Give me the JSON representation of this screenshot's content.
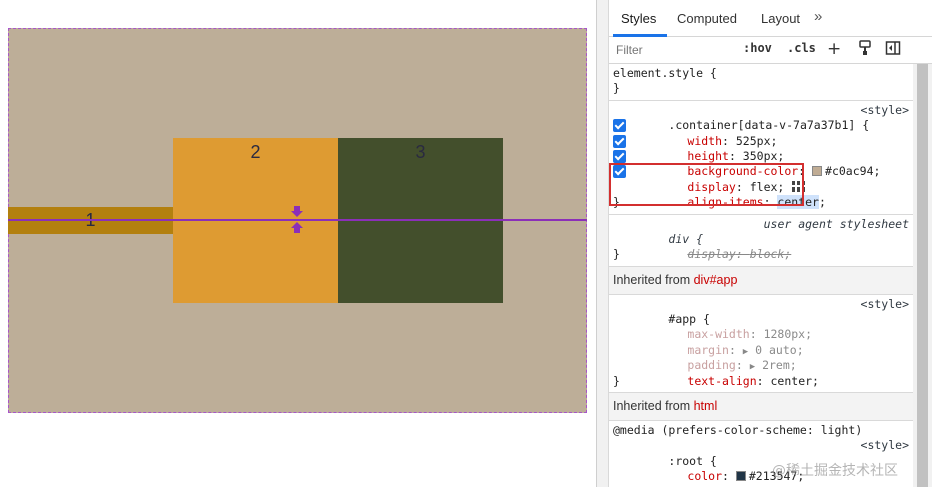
{
  "preview": {
    "box1_label": "1",
    "box2_label": "2",
    "box3_label": "3",
    "colors": {
      "container": "#bdae98",
      "box1": "#b3800f",
      "box2": "#de9b32",
      "box3": "#434f2c",
      "center_line": "#8b2fb8"
    }
  },
  "devtools": {
    "tabs": [
      "Styles",
      "Computed",
      "Layout"
    ],
    "more_tabs_icon": "»",
    "filter_placeholder": "Filter",
    "toolbar": {
      "hov": ":hov",
      "cls": ".cls",
      "plus": "+"
    },
    "rules": {
      "element_style": {
        "selector": "element.style {",
        "close": "}"
      },
      "container": {
        "selector": ".container[data-v-7a7a37b1] {",
        "source": "<style>",
        "decls": [
          {
            "prop": "width",
            "value": "525px;"
          },
          {
            "prop": "height",
            "value": "350px;"
          },
          {
            "prop": "background-color",
            "value": "#c0ac94;"
          },
          {
            "prop": "display",
            "value": "flex;"
          },
          {
            "prop": "align-items",
            "value": "center"
          }
        ],
        "close": "}"
      },
      "div_ua": {
        "selector": "div {",
        "source": "user agent stylesheet",
        "decl_prop": "display",
        "decl_value": "block;",
        "close": "}"
      },
      "inherited_app": {
        "header_prefix": "Inherited from",
        "header_tag": "div#app",
        "selector": "#app {",
        "source": "<style>",
        "decls": [
          {
            "prop": "max-width",
            "value": "1280px;"
          },
          {
            "prop": "margin",
            "value": "0 auto;"
          },
          {
            "prop": "padding",
            "value": "2rem;"
          },
          {
            "prop": "text-align",
            "value": "center;"
          }
        ],
        "close": "}"
      },
      "inherited_html": {
        "header_prefix": "Inherited from",
        "header_tag": "html",
        "media": "@media (prefers-color-scheme: light)",
        "selector": ":root {",
        "source": "<style>",
        "decl_prop": "color",
        "decl_value": "#213547;"
      }
    }
  },
  "watermark": "@稀土掘金技术社区"
}
